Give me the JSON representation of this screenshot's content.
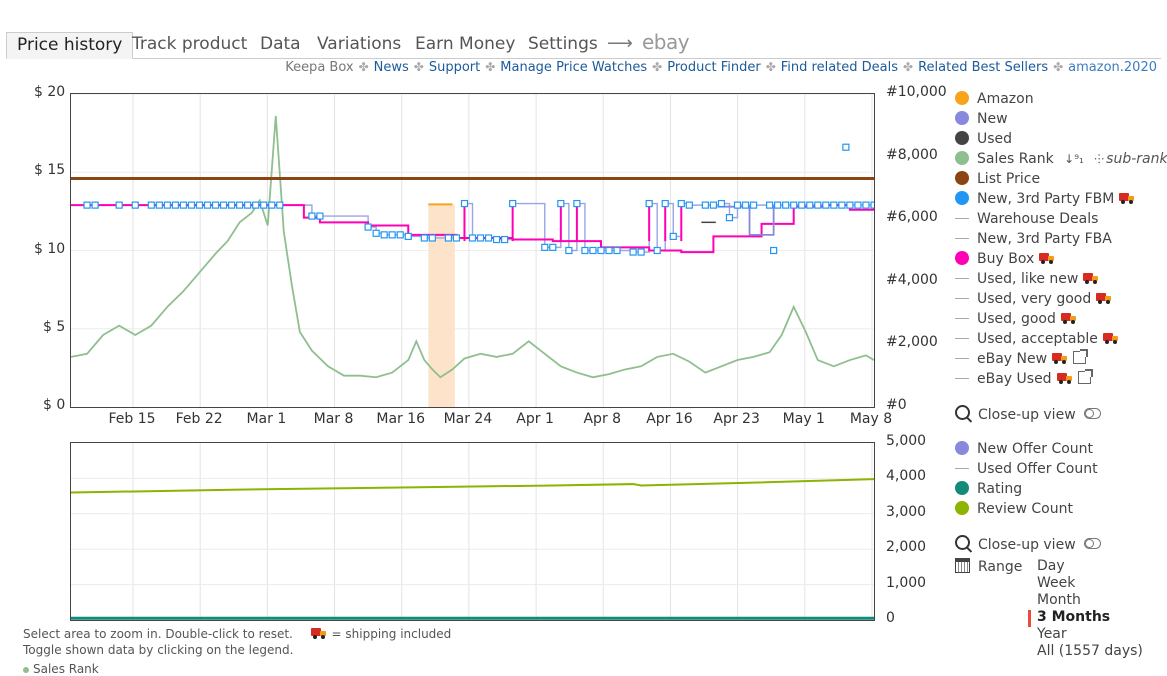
{
  "tabs": {
    "price_history": "Price history",
    "track_product": "Track product",
    "data": "Data",
    "variations": "Variations",
    "earn_money": "Earn Money",
    "settings": "Settings",
    "arrow": "⟶",
    "ebay": "ebay"
  },
  "links": {
    "keepa_box": "Keepa Box",
    "news": "News",
    "support": "Support",
    "manage_watches": "Manage Price Watches",
    "product_finder": "Product Finder",
    "related_deals": "Find related Deals",
    "best_sellers": "Related Best Sellers",
    "amazon": "amazon.2020",
    "sep": "✤"
  },
  "colors": {
    "amazon": "#f7a41d",
    "new": "#8888dd",
    "used": "#444444",
    "sales_rank": "#8fbf8f",
    "list_price": "#8b4513",
    "fbm": "#2196f3",
    "buy_box": "#ff00b4",
    "offer_new": "#8888dd",
    "rating": "#138a7a",
    "review": "#8cb400",
    "highlight": "#fde3c9"
  },
  "chart_data": [
    {
      "type": "line",
      "title": "",
      "y_left_ticks": [
        "$ 20",
        "$ 15",
        "$ 10",
        "$ 5",
        "$ 0"
      ],
      "y_left_range": [
        0,
        20
      ],
      "y_right_ticks": [
        "#10,000",
        "#8,000",
        "#6,000",
        "#4,000",
        "#2,000",
        "#0"
      ],
      "y_right_range": [
        0,
        10000
      ],
      "x_ticks": [
        "Feb 15",
        "Feb 22",
        "Mar 1",
        "Mar 8",
        "Mar 16",
        "Mar 24",
        "Apr 1",
        "Apr 8",
        "Apr 16",
        "Apr 23",
        "May 1",
        "May 8"
      ],
      "series": [
        {
          "name": "List Price",
          "x": [
            0,
            100
          ],
          "y": [
            14.6,
            14.6
          ]
        },
        {
          "name": "Buy Box",
          "x": [
            0,
            25,
            29,
            31,
            37,
            42,
            48,
            55,
            60,
            66,
            72,
            76,
            80,
            86,
            90,
            94,
            97,
            100
          ],
          "y": [
            12.9,
            12.9,
            12.1,
            11.8,
            11.6,
            11.0,
            10.8,
            10.7,
            10.6,
            10.2,
            10.0,
            9.9,
            10.9,
            11.7,
            12.8,
            12.9,
            12.6,
            12.9
          ]
        },
        {
          "name": "Amazon",
          "x": [
            44.5,
            47.5
          ],
          "y": [
            12.95,
            12.95
          ]
        },
        {
          "name": "Used",
          "x": [
            78.5,
            80.3
          ],
          "y": [
            11.8,
            11.8
          ]
        },
        {
          "name": "New",
          "x": [
            80.5,
            84.5,
            87.5
          ],
          "y": [
            12.8,
            11.0,
            12.9
          ]
        },
        {
          "name": "New, 3rd Party FBM",
          "x": [
            2,
            3,
            6,
            8,
            10,
            11,
            12,
            13,
            14,
            15,
            16,
            17,
            18,
            19,
            20,
            21,
            22,
            23,
            24,
            25,
            26,
            30,
            31,
            37,
            38,
            39,
            40,
            41,
            42,
            44,
            45,
            47,
            48,
            49,
            50,
            51,
            52,
            53,
            54,
            55,
            59,
            60,
            61,
            62,
            63,
            64,
            65,
            66,
            67,
            68,
            70,
            71,
            72,
            73,
            74,
            75,
            76,
            77,
            79,
            80,
            81,
            82,
            83,
            84,
            85,
            87,
            88,
            89,
            90,
            91,
            92,
            93,
            94,
            95,
            96,
            97,
            98,
            99,
            100
          ],
          "y": [
            12.9,
            12.9,
            12.9,
            12.9,
            12.9,
            12.9,
            12.9,
            12.9,
            12.9,
            12.9,
            12.9,
            12.9,
            12.9,
            12.9,
            12.9,
            12.9,
            12.9,
            12.9,
            12.9,
            12.9,
            12.9,
            12.2,
            12.2,
            11.5,
            11.1,
            11.0,
            11.0,
            11.0,
            10.9,
            10.8,
            10.8,
            10.8,
            10.8,
            13.0,
            10.8,
            10.8,
            10.8,
            10.7,
            10.7,
            13.0,
            10.2,
            10.2,
            13.0,
            10.0,
            13.0,
            10.0,
            10.0,
            10.0,
            10.0,
            10.0,
            9.9,
            9.9,
            13.0,
            10.0,
            13.0,
            10.9,
            13.0,
            12.9,
            12.9,
            12.9,
            13.0,
            12.1,
            12.9,
            12.9,
            12.9,
            12.9,
            12.9,
            12.9,
            12.9,
            12.9,
            12.9,
            12.9,
            12.9,
            12.9,
            12.9,
            12.9,
            12.9,
            12.9,
            12.9
          ]
        },
        {
          "name": "New, 3rd Party FBM (outlier)",
          "x": [
            96.5,
            87.5
          ],
          "y": [
            16.6,
            10.0
          ]
        },
        {
          "name": "Sales Rank",
          "x": [
            0,
            2,
            4,
            6,
            8,
            10,
            12,
            14,
            16,
            18,
            19.5,
            21,
            22.5,
            23.5,
            24.5,
            25.5,
            26.5,
            27.5,
            28.5,
            30,
            32,
            34,
            36,
            38,
            40,
            42,
            43,
            44,
            45,
            46,
            47.5,
            49,
            51,
            53,
            55,
            57,
            59,
            61,
            63,
            65,
            67,
            69,
            71,
            73,
            75,
            77,
            79,
            81,
            83,
            85,
            87,
            88.5,
            90,
            91.5,
            93,
            95,
            97,
            99,
            100
          ],
          "y": [
            1600,
            1700,
            2300,
            2600,
            2300,
            2600,
            3200,
            3700,
            4300,
            4900,
            5300,
            5900,
            6200,
            6600,
            5800,
            9300,
            5600,
            3900,
            2400,
            1800,
            1300,
            1000,
            1000,
            950,
            1100,
            1500,
            2100,
            1500,
            1200,
            950,
            1200,
            1550,
            1700,
            1600,
            1700,
            2100,
            1700,
            1300,
            1100,
            950,
            1050,
            1200,
            1300,
            1600,
            1700,
            1450,
            1100,
            1300,
            1500,
            1600,
            1750,
            2300,
            3200,
            2400,
            1500,
            1300,
            1500,
            1650,
            1500
          ]
        }
      ],
      "highlight": {
        "x": [
          44.5,
          47.8
        ]
      }
    },
    {
      "type": "line",
      "title": "",
      "y_right_ticks": [
        "5,000",
        "4,000",
        "3,000",
        "2,000",
        "1,000",
        "0"
      ],
      "y_right_range": [
        0,
        5000
      ],
      "series": [
        {
          "name": "Review Count",
          "x": [
            0,
            20,
            40,
            60,
            70,
            71,
            85,
            100
          ],
          "y": [
            3600,
            3680,
            3740,
            3800,
            3840,
            3800,
            3880,
            3980
          ]
        },
        {
          "name": "Rating",
          "x": [
            0,
            100
          ],
          "y": [
            20,
            20
          ]
        }
      ]
    }
  ],
  "legend": {
    "amazon": "Amazon",
    "new": "New",
    "used": "Used",
    "sales_rank": "Sales Rank",
    "sub_ranks": "sub-ranks",
    "list_price": "List Price",
    "fbm": "New, 3rd Party FBM",
    "warehouse": "Warehouse Deals",
    "fba": "New, 3rd Party FBA",
    "buy_box": "Buy Box",
    "used_like_new": "Used, like new",
    "used_very_good": "Used, very good",
    "used_good": "Used, good",
    "used_acceptable": "Used, acceptable",
    "ebay_new": "eBay New",
    "ebay_used": "eBay Used",
    "closeup": "Close-up view",
    "new_offer_count": "New Offer Count",
    "used_offer_count": "Used Offer Count",
    "rating": "Rating",
    "review_count": "Review Count",
    "closeup2": "Close-up view",
    "range": "Range"
  },
  "range_options": [
    "Day",
    "Week",
    "Month",
    "3 Months",
    "Year",
    "All (1557 days)"
  ],
  "range_selected": "3 Months",
  "notes": {
    "zoom": "Select area to zoom in. Double-click to reset.",
    "shipping": "= shipping included",
    "toggle": "Toggle shown data by clicking on the legend.",
    "bottom_cut": "Sales Rank"
  }
}
